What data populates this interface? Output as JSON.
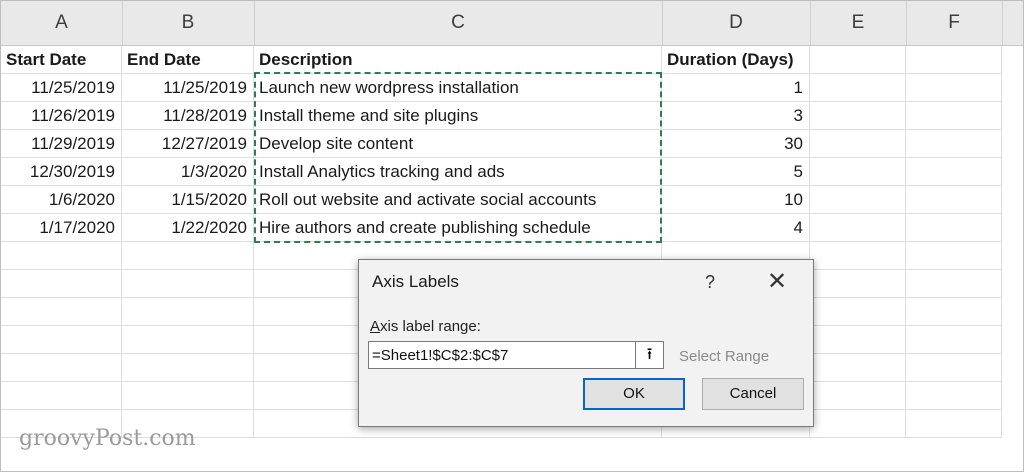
{
  "columns": [
    "A",
    "B",
    "C",
    "D",
    "E",
    "F"
  ],
  "headers": {
    "a": "Start Date",
    "b": "End Date",
    "c": "Description",
    "d": "Duration (Days)"
  },
  "rows": [
    {
      "start": "11/25/2019",
      "end": "11/25/2019",
      "description": "Launch new wordpress installation",
      "duration": "1"
    },
    {
      "start": "11/26/2019",
      "end": "11/28/2019",
      "description": "Install theme and site plugins",
      "duration": "3"
    },
    {
      "start": "11/29/2019",
      "end": "12/27/2019",
      "description": "Develop site content",
      "duration": "30"
    },
    {
      "start": "12/30/2019",
      "end": "1/3/2020",
      "description": "Install Analytics tracking and ads",
      "duration": "5"
    },
    {
      "start": "1/6/2020",
      "end": "1/15/2020",
      "description": "Roll out website and activate social accounts",
      "duration": "10"
    },
    {
      "start": "1/17/2020",
      "end": "1/22/2020",
      "description": "Hire authors and create publishing schedule",
      "duration": "4"
    }
  ],
  "dialog": {
    "title": "Axis Labels",
    "help": "?",
    "close": "✕",
    "label_accel": "A",
    "label_rest": "xis label range:",
    "input_value": "=Sheet1!$C$2:$C$7",
    "collapse_icon": "⭱",
    "select_range": "Select Range",
    "ok": "OK",
    "cancel": "Cancel"
  },
  "watermark": "groovyPost.com",
  "colors": {
    "marquee": "#2e7d4f",
    "ok_border": "#0a64c8"
  }
}
